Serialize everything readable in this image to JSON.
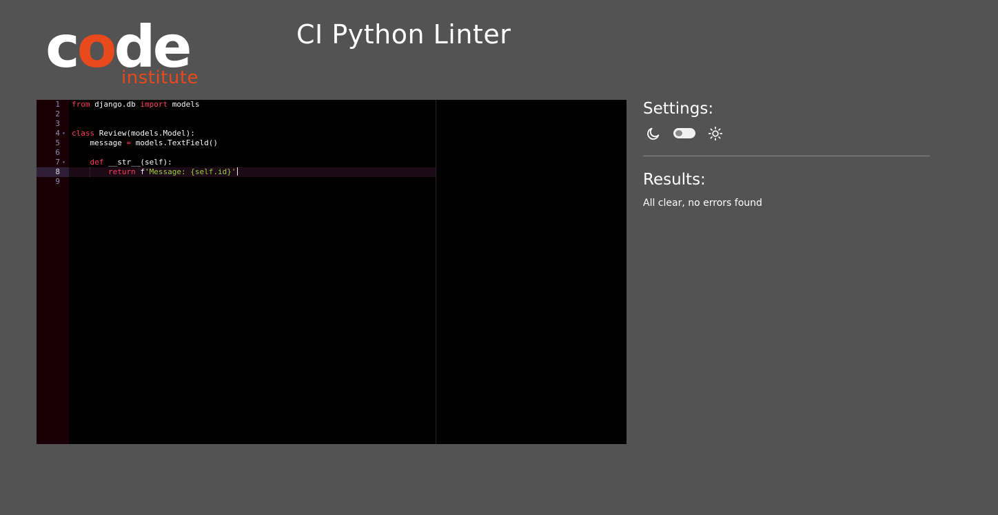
{
  "logo": {
    "code_before": "c",
    "code_accent": "o",
    "code_after": "de",
    "subtitle": "institute",
    "accent_color": "#e8491d"
  },
  "header": {
    "title": "CI Python Linter"
  },
  "editor": {
    "theme": "dark",
    "active_line": 8,
    "lines": [
      {
        "num": "1",
        "fold": false,
        "tokens": [
          {
            "t": "from",
            "c": "kw"
          },
          {
            "t": " django.db ",
            "c": ""
          },
          {
            "t": "import",
            "c": "kw"
          },
          {
            "t": " models",
            "c": ""
          }
        ]
      },
      {
        "num": "2",
        "fold": false,
        "tokens": []
      },
      {
        "num": "3",
        "fold": false,
        "tokens": []
      },
      {
        "num": "4",
        "fold": true,
        "tokens": [
          {
            "t": "class",
            "c": "kw"
          },
          {
            "t": " Review(models.Model):",
            "c": ""
          }
        ]
      },
      {
        "num": "5",
        "fold": false,
        "tokens": [
          {
            "t": "    message ",
            "c": ""
          },
          {
            "t": "=",
            "c": "op"
          },
          {
            "t": " models.TextField()",
            "c": ""
          }
        ]
      },
      {
        "num": "6",
        "fold": false,
        "tokens": []
      },
      {
        "num": "7",
        "fold": true,
        "tokens": [
          {
            "t": "    ",
            "c": ""
          },
          {
            "t": "def",
            "c": "kw"
          },
          {
            "t": " __str__(self):",
            "c": ""
          }
        ]
      },
      {
        "num": "8",
        "fold": false,
        "tokens": [
          {
            "t": "        ",
            "c": ""
          },
          {
            "t": "return",
            "c": "kw"
          },
          {
            "t": " f",
            "c": ""
          },
          {
            "t": "'Message: {self.id}'",
            "c": "str"
          }
        ]
      },
      {
        "num": "9",
        "fold": false,
        "tokens": []
      }
    ]
  },
  "settings": {
    "heading": "Settings:",
    "theme_toggle_state": "dark",
    "dark_icon": "moon-icon",
    "light_icon": "sun-icon"
  },
  "results": {
    "heading": "Results:",
    "message": "All clear, no errors found"
  }
}
